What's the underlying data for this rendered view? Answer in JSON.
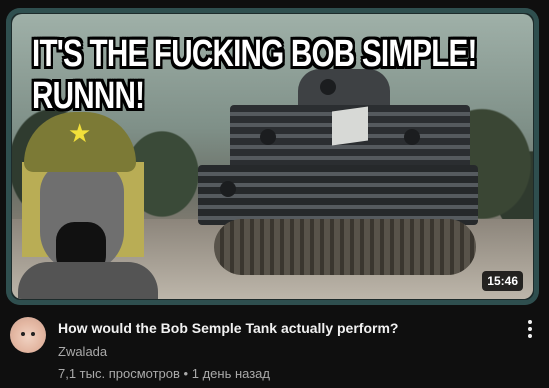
{
  "video": {
    "thumbnail_caption_line1": "IT'S THE FUCKING BOB SIMPLE!",
    "thumbnail_caption_line2": "RUNNN!",
    "duration": "15:46",
    "title": "How would the Bob Semple Tank actually perform?",
    "channel": "Zwalada",
    "views": "7,1 тыс. просмотров",
    "separator": "•",
    "uploaded": "1 день назад"
  },
  "icons": {
    "menu": "more-vert-icon",
    "badge": "star-icon"
  },
  "colors": {
    "background": "#0f0f0f",
    "title_text": "#f1f1f1",
    "secondary_text": "#aaaaaa",
    "thumbnail_border": "#2f4f4f"
  }
}
